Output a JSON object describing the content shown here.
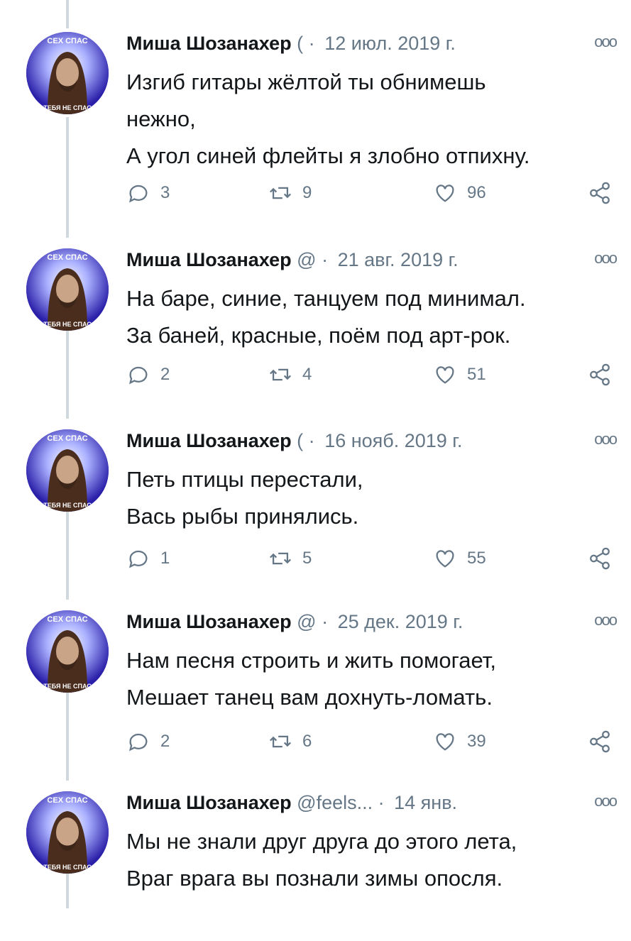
{
  "tweets": [
    {
      "name": "Миша Шозанахер",
      "handle": "(",
      "separator": "·",
      "date": "12 июл. 2019 г.",
      "more": "ooo",
      "lines": [
        "Изгиб гитары жёлтой ты обнимешь",
        "нежно,",
        "А угол синей флейты я злобно отпихну."
      ],
      "replies": "3",
      "retweets": "9",
      "likes": "96"
    },
    {
      "name": "Миша Шозанахер",
      "handle": "@",
      "separator": "·",
      "date": "21 авг. 2019 г.",
      "more": "ooo",
      "lines": [
        "На баре, синие, танцуем под минимал.",
        "За баней, красные, поём под арт-рок."
      ],
      "replies": "2",
      "retweets": "4",
      "likes": "51"
    },
    {
      "name": "Миша Шозанахер",
      "handle": "(",
      "separator": "·",
      "date": "16 нояб. 2019 г.",
      "more": "ooo",
      "lines": [
        "Петь птицы перестали,",
        "Вась рыбы принялись."
      ],
      "replies": "1",
      "retweets": "5",
      "likes": "55"
    },
    {
      "name": "Миша Шозанахер",
      "handle": "@",
      "separator": "·",
      "date": "25 дек. 2019 г.",
      "more": "ooo",
      "lines": [
        "Нам песня строить и жить помогает,",
        "Мешает танец вам дохнуть-ломать."
      ],
      "replies": "2",
      "retweets": "6",
      "likes": "39"
    },
    {
      "name": "Миша Шозанахер",
      "handle": "@feels...",
      "separator": "·",
      "date": "14 янв.",
      "more": "ooo",
      "lines": [
        "Мы не знали друг друга до этого лета,",
        "Враг врага вы познали зимы опосля."
      ]
    }
  ],
  "avatar": {
    "text_top": "СЕХ СПАС",
    "text_bottom": "ТЕБЯ НЕ СПАС",
    "colors": {
      "bg": "#3a2fc8",
      "face": "#c9a487",
      "hair": "#4a2d1c"
    }
  },
  "colors": {
    "text": "#14171a",
    "secondary": "#657786",
    "thread": "#cfd9de"
  }
}
